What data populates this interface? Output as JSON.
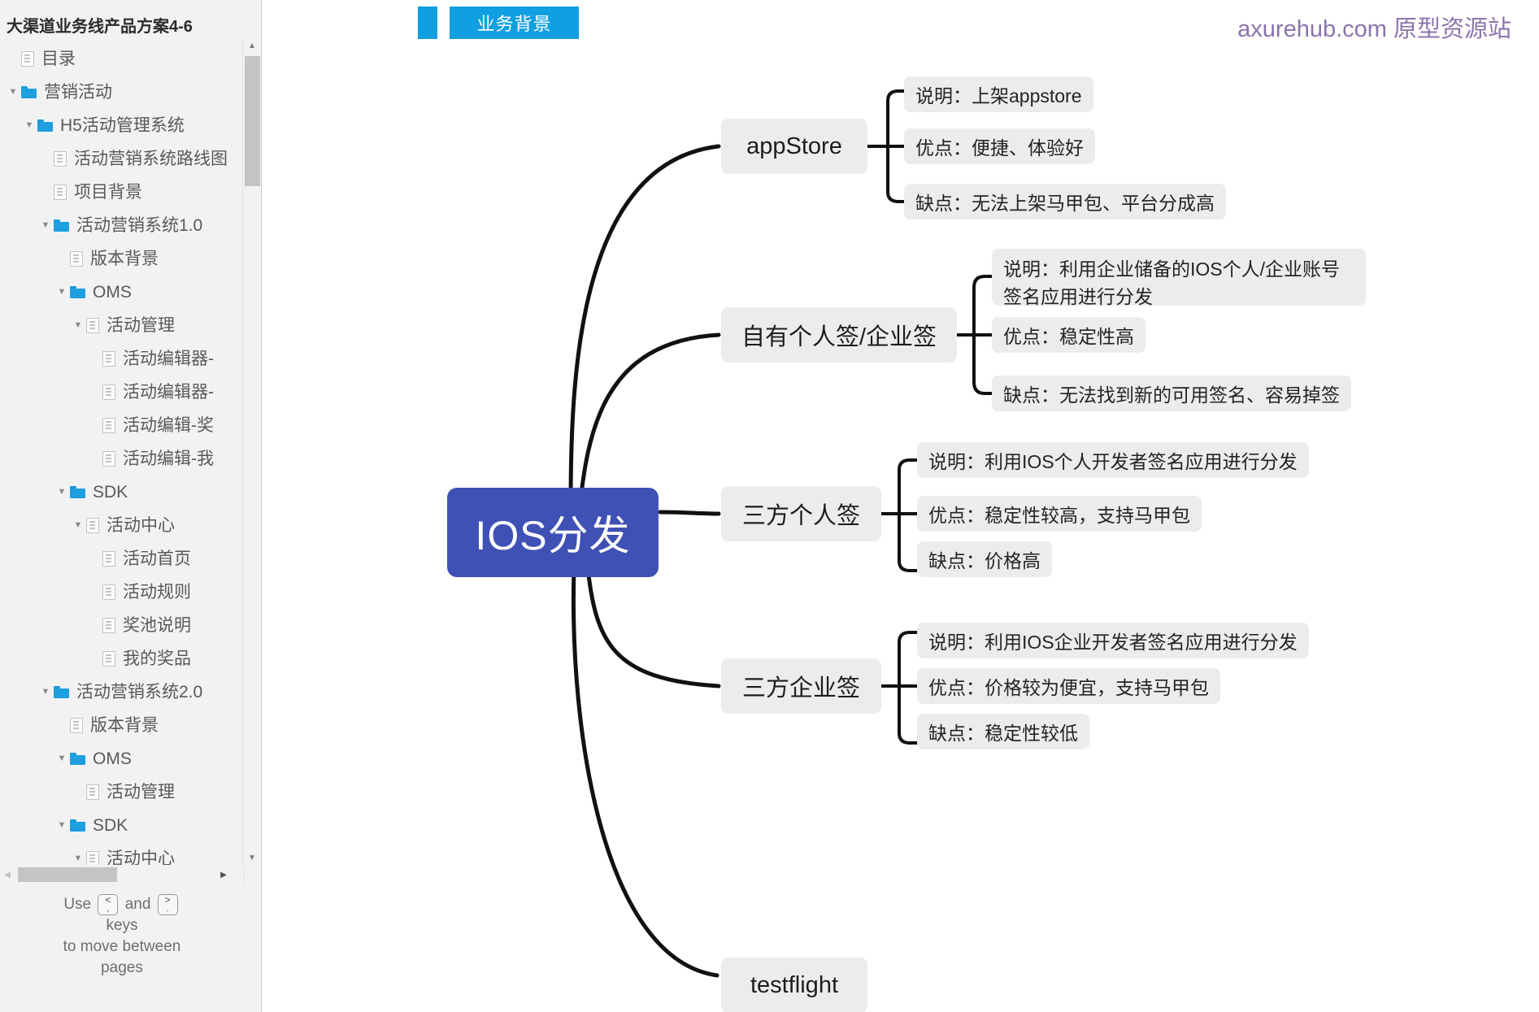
{
  "sidebar": {
    "title": "大渠道业务线产品方案4-6",
    "tree": [
      {
        "indent": 0,
        "arrow": "none",
        "icon": "page",
        "label": "目录"
      },
      {
        "indent": 0,
        "arrow": "expanded",
        "icon": "folder",
        "label": "营销活动"
      },
      {
        "indent": 1,
        "arrow": "expanded",
        "icon": "folder",
        "label": "H5活动管理系统"
      },
      {
        "indent": 2,
        "arrow": "none",
        "icon": "page",
        "label": "活动营销系统路线图"
      },
      {
        "indent": 2,
        "arrow": "none",
        "icon": "page",
        "label": "项目背景"
      },
      {
        "indent": 2,
        "arrow": "expanded",
        "icon": "folder",
        "label": "活动营销系统1.0"
      },
      {
        "indent": 3,
        "arrow": "none",
        "icon": "page",
        "label": "版本背景"
      },
      {
        "indent": 3,
        "arrow": "expanded",
        "icon": "folder",
        "label": "OMS"
      },
      {
        "indent": 4,
        "arrow": "expanded",
        "icon": "page",
        "label": "活动管理"
      },
      {
        "indent": 5,
        "arrow": "none",
        "icon": "page",
        "label": "活动编辑器-"
      },
      {
        "indent": 5,
        "arrow": "none",
        "icon": "page",
        "label": "活动编辑器-"
      },
      {
        "indent": 5,
        "arrow": "none",
        "icon": "page",
        "label": "活动编辑-奖"
      },
      {
        "indent": 5,
        "arrow": "none",
        "icon": "page",
        "label": "活动编辑-我"
      },
      {
        "indent": 3,
        "arrow": "expanded",
        "icon": "folder",
        "label": "SDK"
      },
      {
        "indent": 4,
        "arrow": "expanded",
        "icon": "page",
        "label": "活动中心"
      },
      {
        "indent": 5,
        "arrow": "none",
        "icon": "page",
        "label": "活动首页"
      },
      {
        "indent": 5,
        "arrow": "none",
        "icon": "page",
        "label": "活动规则"
      },
      {
        "indent": 5,
        "arrow": "none",
        "icon": "page",
        "label": "奖池说明"
      },
      {
        "indent": 5,
        "arrow": "none",
        "icon": "page",
        "label": "我的奖品"
      },
      {
        "indent": 2,
        "arrow": "expanded",
        "icon": "folder",
        "label": "活动营销系统2.0"
      },
      {
        "indent": 3,
        "arrow": "none",
        "icon": "page",
        "label": "版本背景"
      },
      {
        "indent": 3,
        "arrow": "expanded",
        "icon": "folder",
        "label": "OMS"
      },
      {
        "indent": 4,
        "arrow": "none",
        "icon": "page",
        "label": "活动管理"
      },
      {
        "indent": 3,
        "arrow": "expanded",
        "icon": "folder",
        "label": "SDK"
      },
      {
        "indent": 4,
        "arrow": "expanded",
        "icon": "page",
        "label": "活动中心"
      }
    ],
    "page_hint": {
      "use": "Use",
      "and": "and",
      "key_prev_top": "<",
      "key_prev_bottom": ",",
      "key_next_top": ">",
      "key_next_bottom": ".",
      "line2": "keys",
      "line3": "to move between",
      "line4": "pages"
    }
  },
  "header": {
    "tab_label": "业务背景",
    "watermark": "axurehub.com 原型资源站",
    "accent_blue": "#109fe0",
    "watermark_color": "#8b74ab"
  },
  "mindmap": {
    "root": "IOS分发",
    "root_color": "#3f51b5",
    "node_bg": "#ececec",
    "branches": [
      {
        "name": "appStore",
        "leaves": [
          "说明：上架appstore",
          "优点：便捷、体验好",
          "缺点：无法上架马甲包、平台分成高"
        ]
      },
      {
        "name": "自有个人签/企业签",
        "leaves": [
          "说明：利用企业储备的IOS个人/企业账号签名应用进行分发",
          "优点：稳定性高",
          "缺点：无法找到新的可用签名、容易掉签"
        ]
      },
      {
        "name": "三方个人签",
        "leaves": [
          "说明：利用IOS个人开发者签名应用进行分发",
          "优点：稳定性较高，支持马甲包",
          "缺点：价格高"
        ]
      },
      {
        "name": "三方企业签",
        "leaves": [
          "说明：利用IOS企业开发者签名应用进行分发",
          "优点：价格较为便宜，支持马甲包",
          "缺点：稳定性较低"
        ]
      },
      {
        "name": "testflight",
        "leaves": []
      }
    ]
  }
}
